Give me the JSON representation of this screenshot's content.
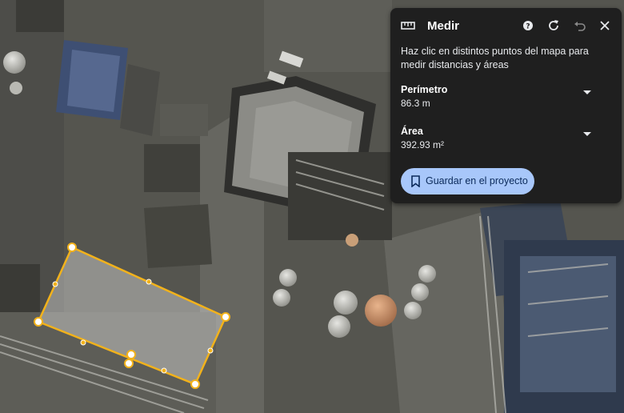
{
  "panel": {
    "title": "Medir",
    "description": "Haz clic en distintos puntos del mapa para medir distancias y áreas",
    "perimeter": {
      "label": "Perímetro",
      "value": "86.3 m"
    },
    "area": {
      "label": "Área",
      "value": "392.93 m²"
    },
    "save_label": "Guardar en el proyecto",
    "icons": [
      "ruler-icon",
      "help-icon",
      "reload-icon",
      "undo-icon",
      "close-icon"
    ]
  },
  "colors": {
    "panel_bg": "#1f1f1f",
    "button_bg": "#a8c7fa",
    "polygon": "#f2b21b"
  }
}
